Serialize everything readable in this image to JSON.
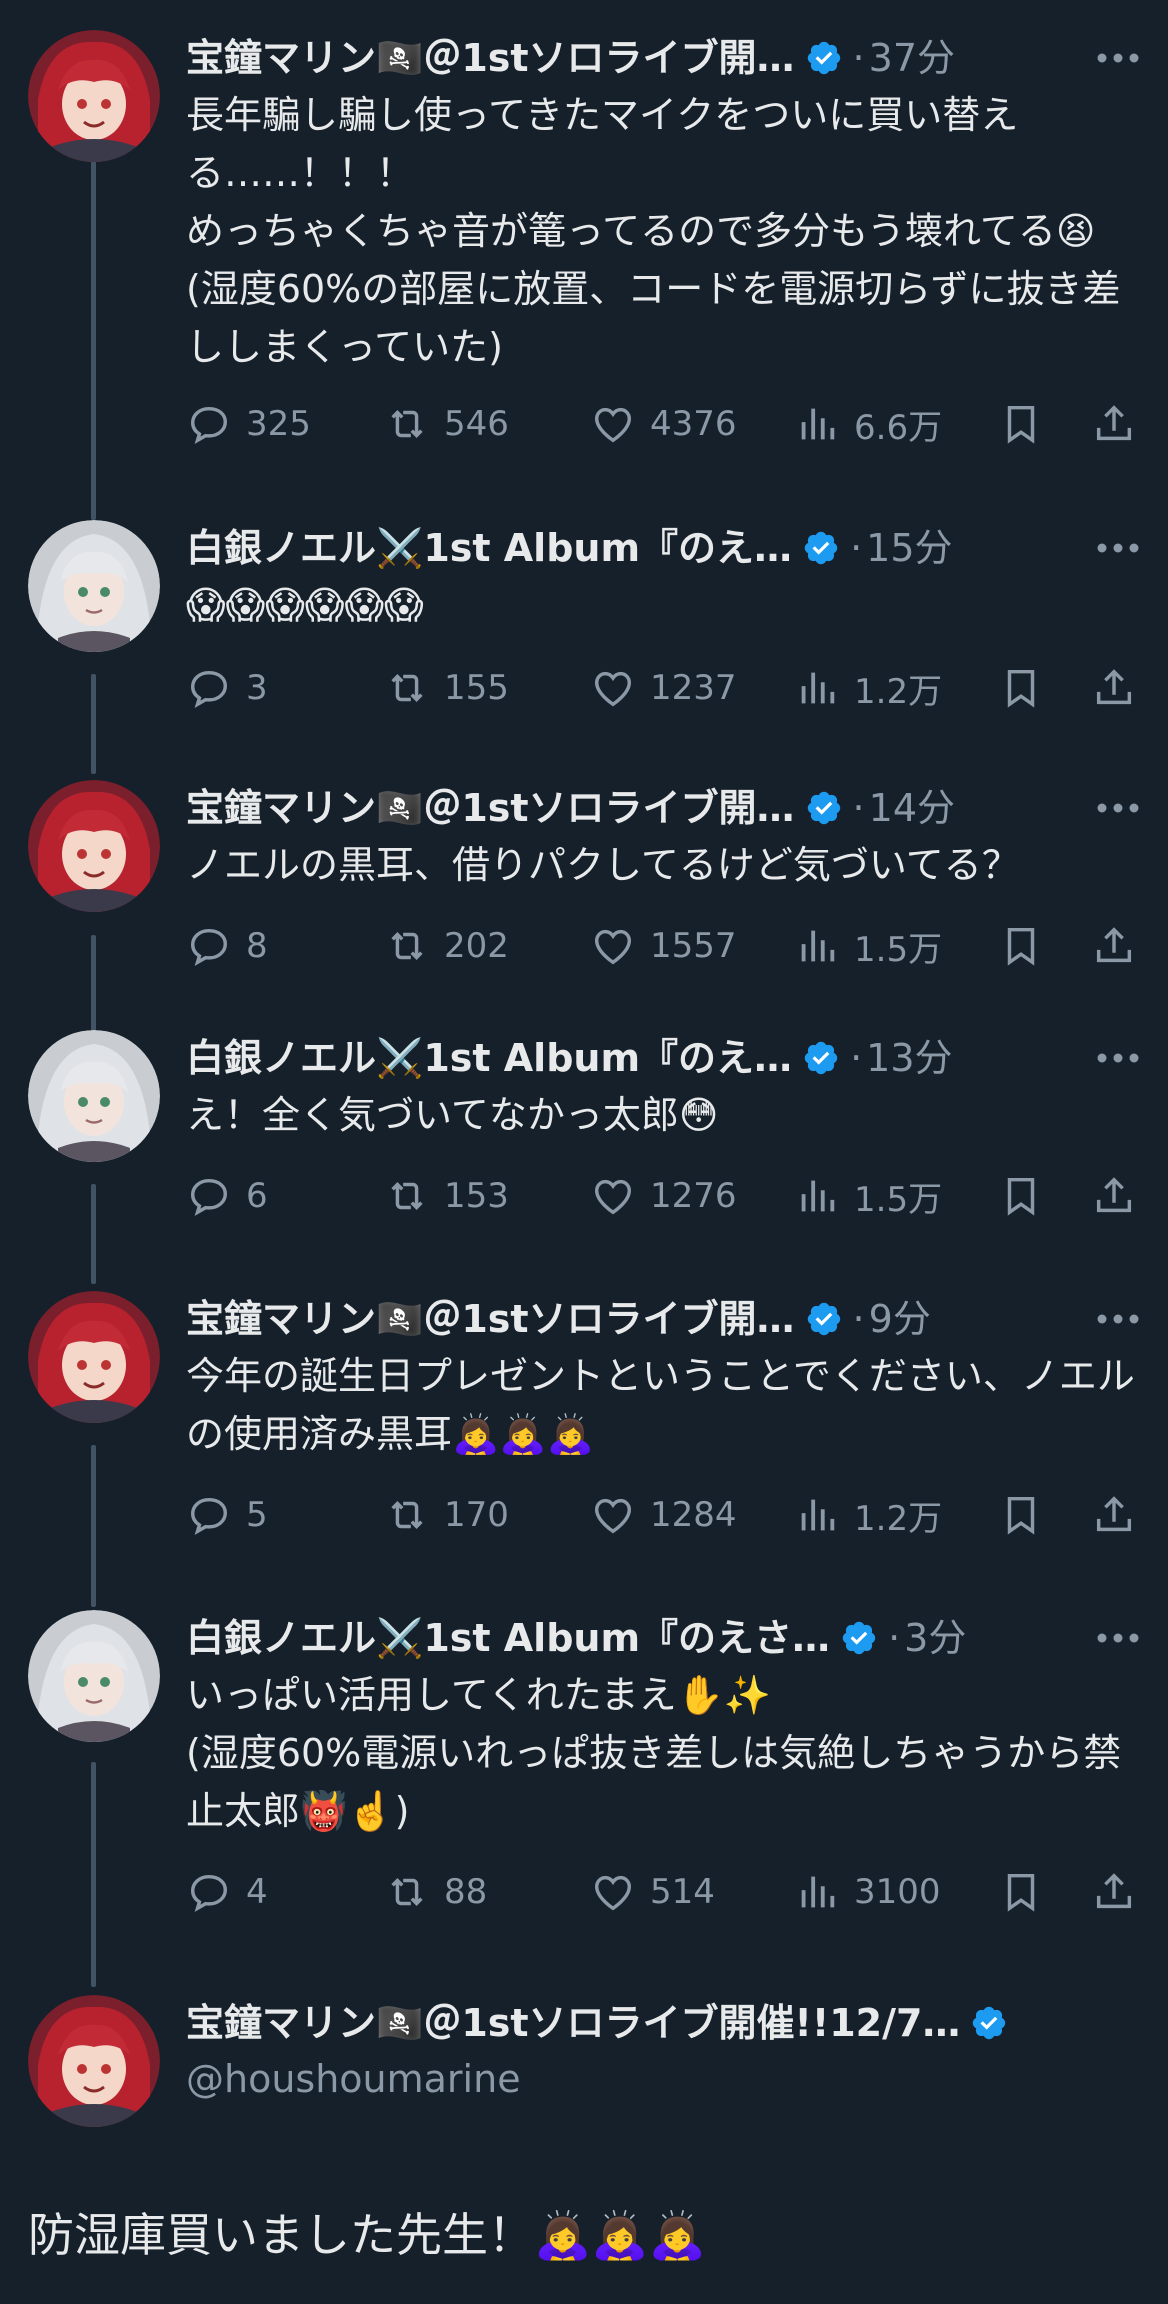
{
  "colors": {
    "background": "#15202b",
    "text": "#e7e9ea",
    "muted": "#8b98a5",
    "verified": "#1d9bf0",
    "thread_line": "#425364"
  },
  "users": {
    "marine": {
      "name": "宝鐘マリン🏴‍☠️＠1stソロライブ開…",
      "name_full": "宝鐘マリン🏴‍☠️＠1stソロライブ開催!!12/7…",
      "handle": "@houshoumarine",
      "avatar": "marine-avatar"
    },
    "noel": {
      "name": "白銀ノエル⚔️1st Album『のえ…",
      "name_long": "白銀ノエル⚔️1st Album『のえさ…",
      "avatar": "noel-avatar"
    }
  },
  "tweets": [
    {
      "author": "宝鐘マリン🏴‍☠️＠1stソロライブ開…",
      "time": "37分",
      "text": "長年騙し騙し使ってきたマイクをついに買い替える……！！！\nめっちゃくちゃ音が篭ってるので多分もう壊れてる😫(湿度60%の部屋に放置、コードを電源切らずに抜き差ししまくっていた)",
      "replies": "325",
      "retweets": "546",
      "likes": "4376",
      "views": "6.6万"
    },
    {
      "author": "白銀ノエル⚔️1st Album『のえ…",
      "time": "15分",
      "text": "😱😱😱😱😱😱",
      "replies": "3",
      "retweets": "155",
      "likes": "1237",
      "views": "1.2万"
    },
    {
      "author": "宝鐘マリン🏴‍☠️＠1stソロライブ開…",
      "time": "14分",
      "text": "ノエルの黒耳、借りパクしてるけど気づいてる？",
      "replies": "8",
      "retweets": "202",
      "likes": "1557",
      "views": "1.5万"
    },
    {
      "author": "白銀ノエル⚔️1st Album『のえ…",
      "time": "13分",
      "text": "え！全く気づいてなかっ太郎😳",
      "replies": "6",
      "retweets": "153",
      "likes": "1276",
      "views": "1.5万"
    },
    {
      "author": "宝鐘マリン🏴‍☠️＠1stソロライブ開…",
      "time": "9分",
      "text": "今年の誕生日プレゼントということでください、ノエルの使用済み黒耳🙇‍♀️🙇‍♀️🙇‍♀️",
      "replies": "5",
      "retweets": "170",
      "likes": "1284",
      "views": "1.2万"
    },
    {
      "author": "白銀ノエル⚔️1st Album『のえさ…",
      "time": "3分",
      "text": "いっぱい活用してくれたまえ✋✨\n(湿度60%電源いれっぱ抜き差しは気絶しちゃうから禁止太郎👹☝️)",
      "replies": "4",
      "retweets": "88",
      "likes": "514",
      "views": "3100"
    }
  ],
  "main_tweet": {
    "author": "宝鐘マリン🏴‍☠️＠1stソロライブ開催!!12/7…",
    "handle": "@houshoumarine",
    "text": "防湿庫買いました先生！🙇‍♀️🙇‍♀️🙇‍♀️"
  },
  "separator": "·",
  "icons": [
    "reply-icon",
    "retweet-icon",
    "like-icon",
    "views-icon",
    "bookmark-icon",
    "share-icon",
    "more-icon",
    "verified-icon"
  ]
}
